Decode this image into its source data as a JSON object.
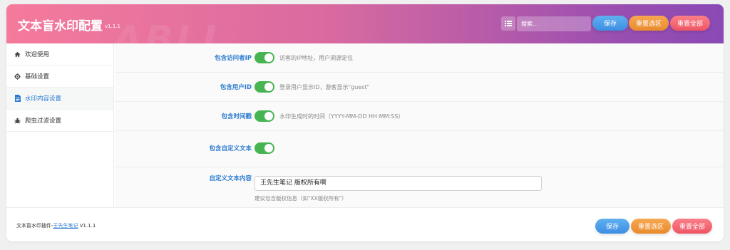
{
  "header": {
    "title": "文本盲水印配置",
    "version": "v1.1.1",
    "watermark": "ABLL",
    "search_placeholder": "搜索...",
    "save_label": "保存",
    "reset_section_label": "重置选区",
    "reset_all_label": "重置全部"
  },
  "sidebar": {
    "items": [
      {
        "label": "欢迎使用",
        "icon": "home-icon"
      },
      {
        "label": "基础设置",
        "icon": "gear-icon"
      },
      {
        "label": "水印内容设置",
        "icon": "document-icon",
        "active": true
      },
      {
        "label": "爬虫过滤设置",
        "icon": "bug-icon"
      }
    ]
  },
  "main": {
    "rows": [
      {
        "label": "包含访问者IP",
        "enabled": true,
        "description": "访客的IP地址，用户溯源定位"
      },
      {
        "label": "包含用户ID",
        "enabled": true,
        "description": "登录用户显示ID，游客显示\"guest\""
      },
      {
        "label": "包含时间戳",
        "enabled": true,
        "description": "水印生成时的时间（YYYY-MM-DD HH:MM:SS）"
      },
      {
        "label": "包含自定义文本",
        "enabled": true,
        "description": ""
      }
    ],
    "custom_text": {
      "label": "自定义文本内容",
      "value": "王先生笔记 版权所有啊",
      "hint": "建议包含版权信息（如\"XX版权所有\"）"
    }
  },
  "footer": {
    "plugin_prefix": "文本盲水印插件-",
    "author_link": "王先生笔记",
    "version": "V1.1.1",
    "save_label": "保存",
    "reset_section_label": "重置选区",
    "reset_all_label": "重置全部"
  },
  "colors": {
    "header_gradient_start": "#f57a9c",
    "header_gradient_end": "#8a49b5",
    "accent_blue": "#2b7bd0",
    "toggle_on": "#46b450"
  }
}
